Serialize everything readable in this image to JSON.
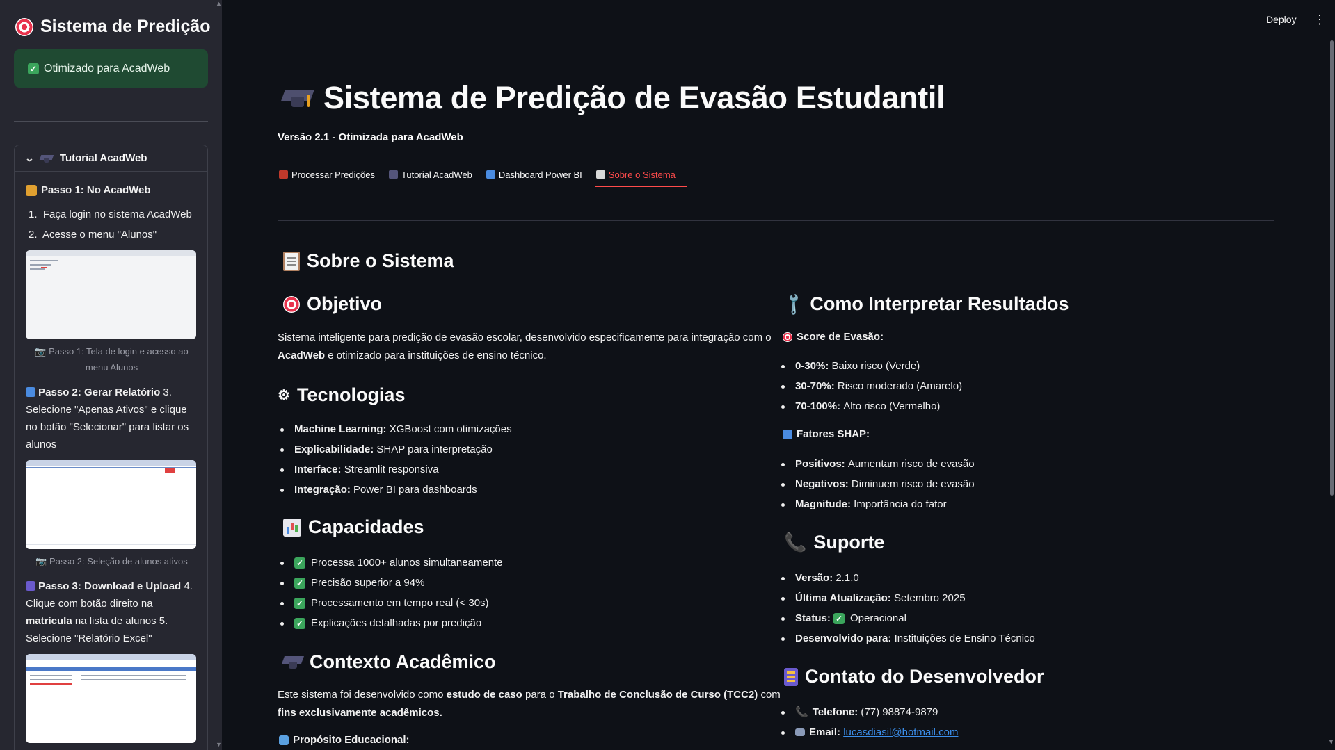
{
  "sidebar": {
    "title": "Sistema de Predição",
    "success": "Otimizado para AcadWeb",
    "expander_title": "Tutorial AcadWeb",
    "step1_title": "Passo 1: No AcadWeb",
    "step1_items": [
      "Faça login no sistema AcadWeb",
      "Acesse o menu \"Alunos\""
    ],
    "step1_caption": "Passo 1: Tela de login e acesso ao menu Alunos",
    "step2_title": "Passo 2: Gerar Relatório",
    "step2_text": "3. Selecione \"Apenas Ativos\" e clique no botão \"Selecionar\" para listar os alunos",
    "step2_caption": "Passo 2: Seleção de alunos ativos",
    "step3_title": "Passo 3: Download e Upload",
    "step3_text_a": "4. Clique com botão direito na",
    "step3_bold": "matrícula",
    "step3_text_b": "na lista de alunos 5. Selecione \"Relatório Excel\""
  },
  "toolbar": {
    "deploy": "Deploy",
    "menu": "⋮"
  },
  "header": {
    "title": "Sistema de Predição de Evasão Estudantil",
    "version": "Versão 2.1 - Otimizada para AcadWeb"
  },
  "tabs": [
    {
      "label": "Processar Predições",
      "color": "#c0392b"
    },
    {
      "label": "Tutorial AcadWeb",
      "color": "#54557a"
    },
    {
      "label": "Dashboard Power BI",
      "color": "#4a8be0"
    },
    {
      "label": "Sobre o Sistema",
      "color": "#d9d9d9"
    }
  ],
  "about": {
    "heading": "Sobre o Sistema",
    "objetivo": {
      "heading": "Objetivo",
      "text_a": "Sistema inteligente para predição de evasão escolar, desenvolvido especificamente para integração com o",
      "text_bold": "AcadWeb",
      "text_b": "e otimizado para instituições de ensino técnico."
    },
    "tecnologias": {
      "heading": "Tecnologias",
      "items": [
        {
          "k": "Machine Learning:",
          "v": "XGBoost com otimizações"
        },
        {
          "k": "Explicabilidade:",
          "v": "SHAP para interpretação"
        },
        {
          "k": "Interface:",
          "v": "Streamlit responsiva"
        },
        {
          "k": "Integração:",
          "v": "Power BI para dashboards"
        }
      ]
    },
    "capacidades": {
      "heading": "Capacidades",
      "items": [
        "Processa 1000+ alunos simultaneamente",
        "Precisão superior a 94%",
        "Processamento em tempo real (< 30s)",
        "Explicações detalhadas por predição"
      ]
    },
    "contexto": {
      "heading": "Contexto Acadêmico",
      "text_a": "Este sistema foi desenvolvido como",
      "bold1": "estudo de caso",
      "text_b": "para o",
      "bold2": "Trabalho de Conclusão de Curso (TCC2)",
      "text_c": "com",
      "bold3": "fins exclusivamente acadêmicos.",
      "proposito": "Propósito Educacional:"
    },
    "interpretar": {
      "heading": "Como Interpretar Resultados",
      "score_title": "Score de Evasão:",
      "score_items": [
        {
          "k": "0-30%:",
          "v": "Baixo risco (Verde)"
        },
        {
          "k": "30-70%:",
          "v": "Risco moderado (Amarelo)"
        },
        {
          "k": "70-100%:",
          "v": "Alto risco (Vermelho)"
        }
      ],
      "shap_title": "Fatores SHAP:",
      "shap_items": [
        {
          "k": "Positivos:",
          "v": "Aumentam risco de evasão"
        },
        {
          "k": "Negativos:",
          "v": "Diminuem risco de evasão"
        },
        {
          "k": "Magnitude:",
          "v": "Importância do fator"
        }
      ]
    },
    "suporte": {
      "heading": "Suporte",
      "items": [
        {
          "k": "Versão:",
          "v": "2.1.0"
        },
        {
          "k": "Última Atualização:",
          "v": "Setembro 2025"
        },
        {
          "k": "Status:",
          "v": "Operacional"
        },
        {
          "k": "Desenvolvido para:",
          "v": "Instituições de Ensino Técnico"
        }
      ]
    },
    "contato": {
      "heading": "Contato do Desenvolvedor",
      "phone_k": "Telefone:",
      "phone_v": "(77) 98874-9879",
      "email_k": "Email:",
      "email_v": "lucasdiasil@hotmail.com"
    }
  }
}
